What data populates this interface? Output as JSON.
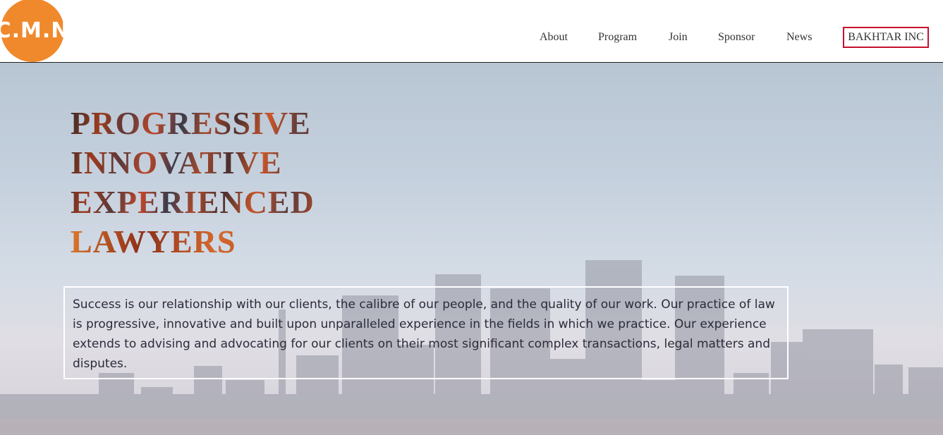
{
  "header": {
    "logo_text": "C.M.N",
    "nav": {
      "about": "About",
      "program": "Program",
      "join": "Join",
      "sponsor": "Sponsor",
      "news": "News",
      "cta": "BAKHTAR INC"
    }
  },
  "hero": {
    "headline": {
      "line1": "PROGRESSIVE",
      "line2": "INNOVATIVE",
      "line3": "EXPERIENCED",
      "line4": "LAWYERS"
    },
    "intro": "Success is our relationship with our clients, the calibre of our people, and the quality of our work. Our practice of law is progressive, innovative and built upon unparalleled experience in the fields in which we practice. Our experience extends to advising and advocating for our clients on their most significant complex transactions, legal matters and disputes."
  },
  "colors": {
    "logo_orange": "#f0892c",
    "cta_border": "#c8102e",
    "sky_top": "#a9b9c9",
    "sky_bottom": "#ccc7cf"
  }
}
